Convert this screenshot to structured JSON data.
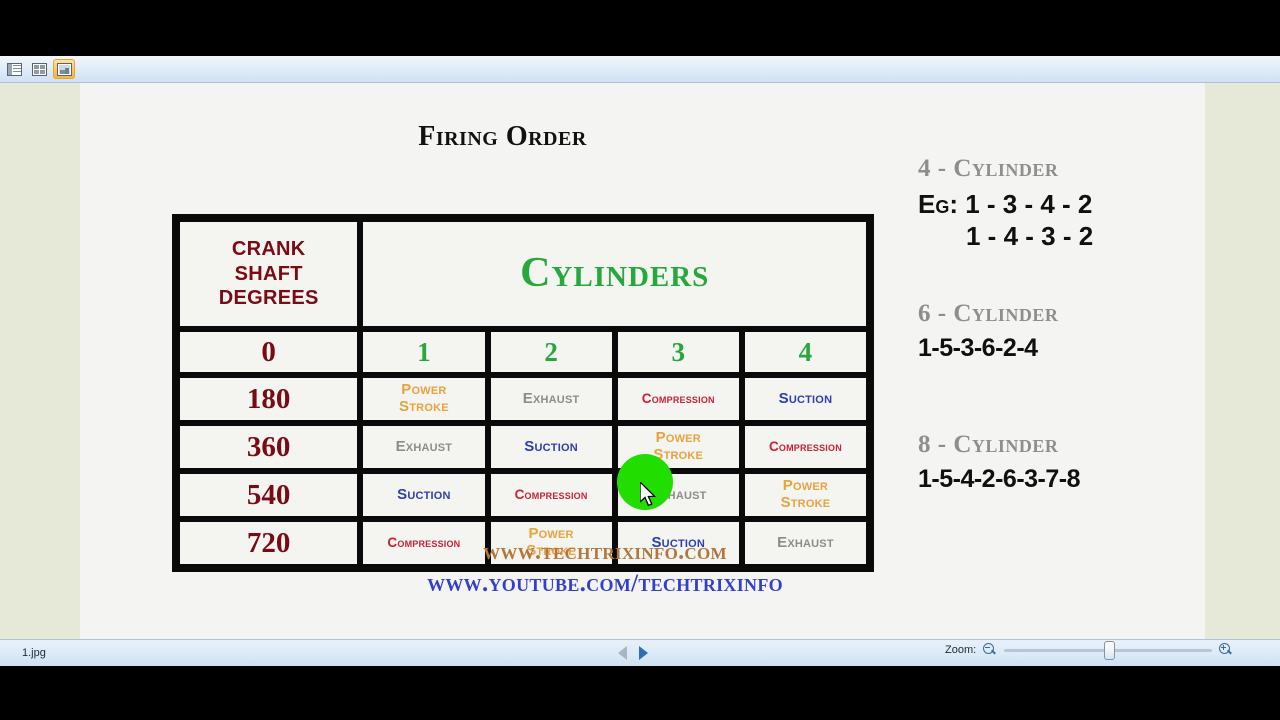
{
  "window": {
    "toolbar": {
      "buttons": [
        {
          "name": "normal-view",
          "icon": "normal-view-icon",
          "active": false
        },
        {
          "name": "slide-sorter-view",
          "icon": "slide-sorter-icon",
          "active": false
        },
        {
          "name": "slide-show-view",
          "icon": "slide-show-icon",
          "active": true
        }
      ]
    },
    "statusbar": {
      "filename": "1.jpg",
      "prev_label": "Previous",
      "next_label": "Next",
      "zoom_label": "Zoom:",
      "zoom_out_icon": "zoom-out-icon",
      "zoom_in_icon": "zoom-in-icon",
      "zoom_value": 50
    }
  },
  "slide": {
    "title": "Firing Order",
    "table": {
      "header": {
        "degrees_label": "CRANK\nSHAFT\nDEGREES",
        "degrees_line1": "CRANK",
        "degrees_line2": "SHAFT",
        "degrees_line3": "DEGREES",
        "cylinders_label": "Cylinders"
      },
      "number_row": {
        "degree": "0",
        "cylinders": [
          "1",
          "2",
          "3",
          "4"
        ]
      },
      "rows": [
        {
          "degree": "180",
          "cells": [
            {
              "label": "Power Stroke",
              "line1": "Power",
              "line2": "Stroke",
              "kind": "power"
            },
            {
              "label": "Exhaust",
              "line1": "Exhaust",
              "line2": "",
              "kind": "exhaust"
            },
            {
              "label": "Compression",
              "line1": "Compression",
              "line2": "",
              "kind": "compression"
            },
            {
              "label": "Suction",
              "line1": "Suction",
              "line2": "",
              "kind": "suction"
            }
          ]
        },
        {
          "degree": "360",
          "cells": [
            {
              "label": "Exhaust",
              "line1": "Exhaust",
              "line2": "",
              "kind": "exhaust"
            },
            {
              "label": "Suction",
              "line1": "Suction",
              "line2": "",
              "kind": "suction"
            },
            {
              "label": "Power Stroke",
              "line1": "Power",
              "line2": "Stroke",
              "kind": "power"
            },
            {
              "label": "Compression",
              "line1": "Compression",
              "line2": "",
              "kind": "compression"
            }
          ]
        },
        {
          "degree": "540",
          "cells": [
            {
              "label": "Suction",
              "line1": "Suction",
              "line2": "",
              "kind": "suction"
            },
            {
              "label": "Compression",
              "line1": "Compression",
              "line2": "",
              "kind": "compression"
            },
            {
              "label": "Exhaust",
              "line1": "Exhaust",
              "line2": "",
              "kind": "exhaust"
            },
            {
              "label": "Power Stroke",
              "line1": "Power",
              "line2": "Stroke",
              "kind": "power"
            }
          ]
        },
        {
          "degree": "720",
          "cells": [
            {
              "label": "Compression",
              "line1": "Compression",
              "line2": "",
              "kind": "compression"
            },
            {
              "label": "Power Stroke",
              "line1": "Power",
              "line2": "Stroke",
              "kind": "power"
            },
            {
              "label": "Suction",
              "line1": "Suction",
              "line2": "",
              "kind": "suction"
            },
            {
              "label": "Exhaust",
              "line1": "Exhaust",
              "line2": "",
              "kind": "exhaust"
            }
          ]
        }
      ]
    },
    "firing_orders": [
      {
        "heading": "4 - Cylinder",
        "line1": "Eg: 1 - 3 - 4 - 2",
        "line2": "1 - 4 - 3 - 2"
      },
      {
        "heading": "6 - Cylinder",
        "line1": "1-5-3-6-2-4",
        "line2": ""
      },
      {
        "heading": "8 - Cylinder",
        "line1": "1-5-4-2-6-3-7-8",
        "line2": ""
      }
    ],
    "footer": {
      "website": "www.techtrixinfo.com",
      "youtube": "www.youtube.com/techtrixinfo"
    }
  },
  "annotation": {
    "click_highlight_color": "#22dd00",
    "cursor_icon": "mouse-pointer-icon"
  },
  "colors": {
    "dark_red": "#7a0a14",
    "green": "#27a83c",
    "power_orange": "#e8a33d",
    "exhaust_gray": "#8c8c8c",
    "compression_red": "#cc2233",
    "suction_blue": "#2b3fb5",
    "side_heading_gray": "#8d8f8d",
    "url_brown": "#b4763c",
    "url_blue": "#3340cc"
  }
}
